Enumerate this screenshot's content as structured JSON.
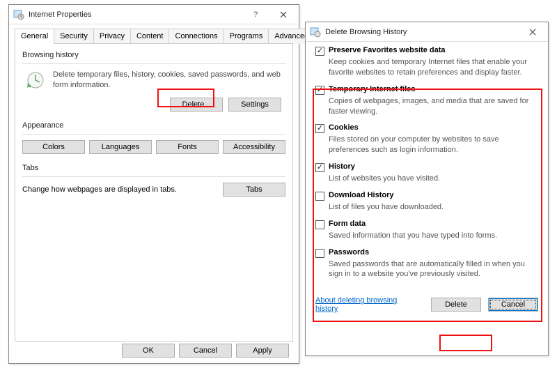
{
  "ip_window": {
    "title": "Internet Properties",
    "tabs": [
      "General",
      "Security",
      "Privacy",
      "Content",
      "Connections",
      "Programs",
      "Advanced"
    ],
    "browsing_history": {
      "label": "Browsing history",
      "desc": "Delete temporary files, history, cookies, saved passwords, and web form information.",
      "delete": "Delete...",
      "settings": "Settings"
    },
    "appearance": {
      "label": "Appearance",
      "colors": "Colors",
      "languages": "Languages",
      "fonts": "Fonts",
      "accessibility": "Accessibility"
    },
    "tabs_section": {
      "label": "Tabs",
      "desc": "Change how webpages are displayed in tabs.",
      "button": "Tabs"
    },
    "buttons": {
      "ok": "OK",
      "cancel": "Cancel",
      "apply": "Apply"
    }
  },
  "dbh_window": {
    "title": "Delete Browsing History",
    "items": [
      {
        "label": "Preserve Favorites website data",
        "desc": "Keep cookies and temporary Internet files that enable your favorite websites to retain preferences and display faster.",
        "checked": true
      },
      {
        "label": "Temporary Internet files",
        "desc": "Copies of webpages, images, and media that are saved for faster viewing.",
        "checked": true
      },
      {
        "label": "Cookies",
        "desc": "Files stored on your computer by websites to save preferences such as login information.",
        "checked": true
      },
      {
        "label": "History",
        "desc": "List of websites you have visited.",
        "checked": true
      },
      {
        "label": "Download History",
        "desc": "List of files you have downloaded.",
        "checked": false
      },
      {
        "label": "Form data",
        "desc": "Saved information that you have typed into forms.",
        "checked": false
      },
      {
        "label": "Passwords",
        "desc": "Saved passwords that are automatically filled in when you sign in to a website you've previously visited.",
        "checked": false
      }
    ],
    "link": "About deleting browsing history",
    "delete": "Delete",
    "cancel": "Cancel"
  }
}
